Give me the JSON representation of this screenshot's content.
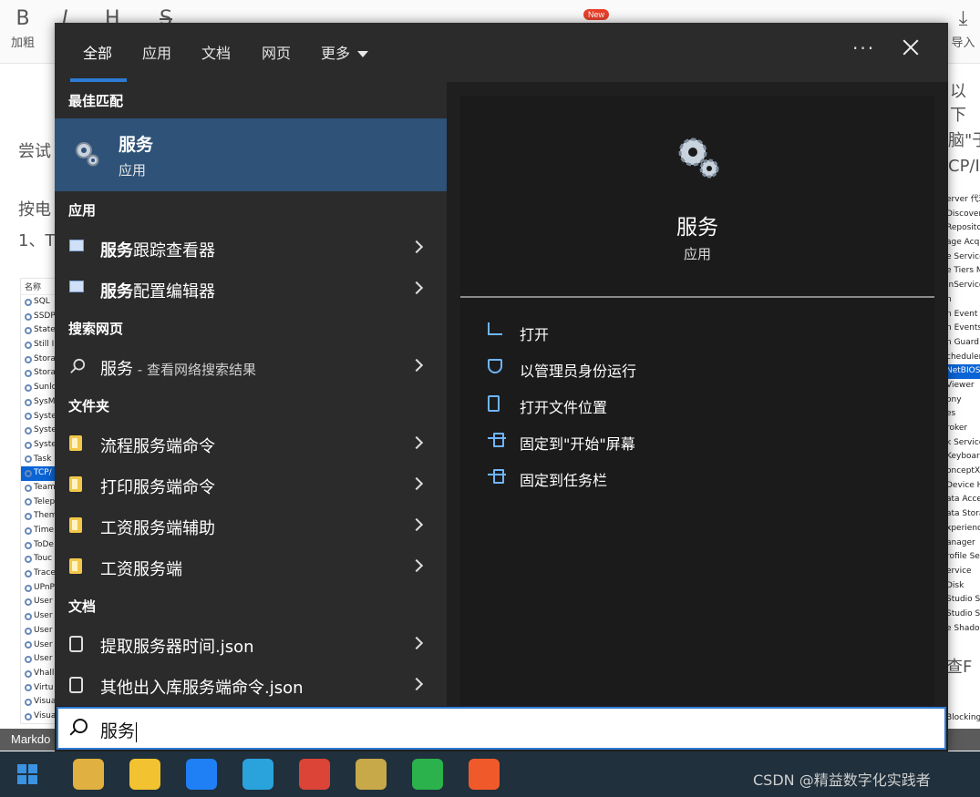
{
  "editor": {
    "toolbar": {
      "bold_glyph": "B",
      "bold_label": "加粗",
      "italic_glyph": "I",
      "heading_glyph": "H",
      "strike_glyph": "S",
      "import_label": "导入",
      "new_badge": "New"
    },
    "text_lines": [
      "尝试",
      "按电",
      "1、T",
      "以下",
      "脑\"于",
      "CP/I",
      "查F"
    ],
    "left_list_header": "名称",
    "left_list_rows": [
      "SQL",
      "SSDP",
      "State",
      "Still I",
      "Stora",
      "Stora",
      "Sunlo",
      "SysM",
      "Syste",
      "Syste",
      "Syste",
      "Task",
      "TCP/",
      "Team",
      "Telep",
      "Them",
      "Time",
      "ToDe",
      "Touc",
      "Trace",
      "UPnP",
      "User",
      "User",
      "User",
      "User",
      "User",
      "Vhall",
      "Virtu",
      "Visua",
      "Visua"
    ],
    "right_list_rows": [
      "erver 代理",
      "Discovery",
      "Repositor",
      "age Acqu",
      "e Service",
      "e Tiers M",
      "inService",
      "n",
      "n Event N",
      "n Events I",
      "n Guard 运",
      "cheduler",
      "NetBIOS",
      "Viewer",
      "ony",
      "es",
      "roker",
      "k Service",
      "Keyboard",
      "onceptX",
      "Device H",
      "ata Acce",
      "ata Stora",
      "xperience",
      "anager",
      "rofile Ser",
      "ervice",
      "Disk",
      "Studio St",
      "Studio St",
      "e Shadow"
    ],
    "right_list_extra": "BlockingS",
    "markdown_label": "Markdo"
  },
  "search_panel": {
    "tabs": [
      {
        "label": "全部",
        "active": true
      },
      {
        "label": "应用",
        "active": false
      },
      {
        "label": "文档",
        "active": false
      },
      {
        "label": "网页",
        "active": false
      },
      {
        "label": "更多",
        "active": false
      }
    ],
    "more_dots": "···",
    "best_match_header": "最佳匹配",
    "best_match": {
      "title": "服务",
      "subtitle": "应用",
      "icon": "services-gear-icon"
    },
    "sections": {
      "apps": "应用",
      "web": "搜索网页",
      "folders": "文件夹",
      "docs": "文档"
    },
    "apps": [
      {
        "bold": "服务",
        "rest": "跟踪查看器"
      },
      {
        "bold": "服务",
        "rest": "配置编辑器"
      }
    ],
    "web": {
      "bold": "服务",
      "rest": " - 查看网络搜索结果"
    },
    "folders": [
      "流程服务端命令",
      "打印服务端命令",
      "工资服务端辅助",
      "工资服务端"
    ],
    "docs": [
      "提取服务器时间.json",
      "其他出入库服务端命令.json"
    ],
    "detail": {
      "title": "服务",
      "subtitle": "应用",
      "actions": [
        "打开",
        "以管理员身份运行",
        "打开文件位置",
        "固定到\"开始\"屏幕",
        "固定到任务栏"
      ]
    },
    "search": {
      "query": "服务"
    }
  },
  "taskbar": {
    "watermark": "CSDN @精益数字化实践者",
    "apps": [
      {
        "name": "tools-app-icon",
        "color": "#e0b040"
      },
      {
        "name": "file-explorer-icon",
        "color": "#f2c230"
      },
      {
        "name": "feishu-icon",
        "color": "#1f7ff5"
      },
      {
        "name": "hbuilder-icon",
        "color": "#2aa3dc"
      },
      {
        "name": "chrome-icon",
        "color": "#db4437"
      },
      {
        "name": "dev-tools-icon",
        "color": "#c8a94a"
      },
      {
        "name": "wechat-icon",
        "color": "#2bb24c"
      },
      {
        "name": "xmind-icon",
        "color": "#f05a2a"
      }
    ]
  }
}
